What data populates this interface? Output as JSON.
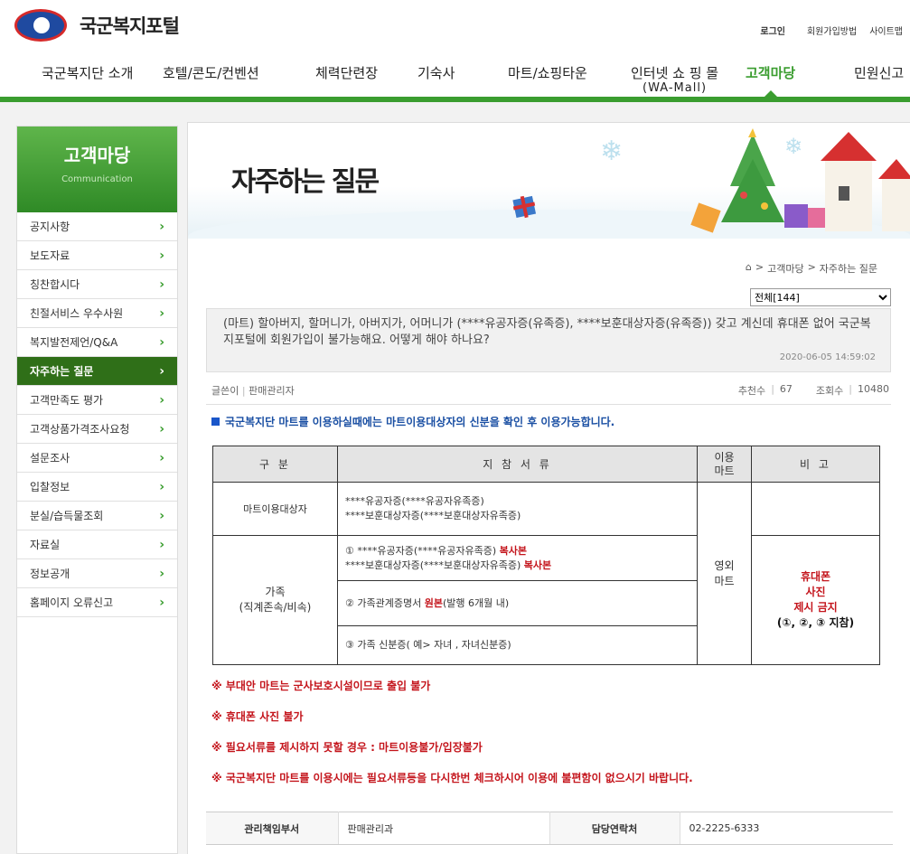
{
  "header": {
    "site_title": "국군복지포털",
    "util": {
      "login": "로그인",
      "signup_guide": "회원가입방법",
      "sitemap": "사이트맵"
    },
    "gnb": [
      {
        "label": "국군복지단 소개"
      },
      {
        "label": "호텔/콘도/컨벤션"
      },
      {
        "label": "체력단련장"
      },
      {
        "label": "기숙사"
      },
      {
        "label": "마트/쇼핑타운"
      },
      {
        "label": "인터넷 쇼 핑 몰",
        "sub": "(WA-Mall)"
      },
      {
        "label": "고객마당",
        "active": true
      },
      {
        "label": "민원신고"
      }
    ]
  },
  "sidebar": {
    "title": "고객마당",
    "subtitle": "Communication",
    "items": [
      {
        "label": "공지사항"
      },
      {
        "label": "보도자료"
      },
      {
        "label": "칭찬합시다"
      },
      {
        "label": "친절서비스 우수사원"
      },
      {
        "label": "복지발전제언/Q&A"
      },
      {
        "label": "자주하는 질문",
        "active": true
      },
      {
        "label": "고객만족도 평가"
      },
      {
        "label": "고객상품가격조사요청"
      },
      {
        "label": "설문조사"
      },
      {
        "label": "입찰정보"
      },
      {
        "label": "분실/습득물조회"
      },
      {
        "label": "자료실"
      },
      {
        "label": "정보공개"
      },
      {
        "label": "홈페이지 오류신고"
      }
    ]
  },
  "content": {
    "page_title": "자주하는 질문",
    "breadcrumb": {
      "home_icon": "home-icon",
      "level1": "고객마당",
      "level2": "자주하는 질문"
    },
    "filter": {
      "selected": "전체[144]"
    },
    "question": {
      "text": "(마트) 할아버지, 할머니가, 아버지가, 어머니가 (****유공자증(유족증), ****보훈대상자증(유족증)) 갖고 계신데 휴대폰 없어 국군복지포털에 회원가입이 불가능해요. 어떻게 해야 하나요?",
      "date": "2020-06-05 14:59:02"
    },
    "meta": {
      "writer_label": "글쓴이",
      "writer": "판매관리자",
      "recommend_label": "추천수",
      "recommend": "67",
      "views_label": "조회수",
      "views": "10480"
    },
    "notice": "국군복지단 마트를 이용하실때에는 마트이용대상자의 신분을 확인 후 이용가능합니다.",
    "table": {
      "headers": {
        "category": "구 분",
        "docs": "지 참 서 류",
        "mart": "이용\n마트",
        "note": "비 고"
      },
      "row1": {
        "category": "마트이용대상자",
        "doc_line1": "****유공자증(****유공자유족증)",
        "doc_line2": "****보훈대상자증(****보훈대상자유족증)"
      },
      "row2": {
        "category_line1": "가족",
        "category_line2": "(직계존속/비속)",
        "doc1_line1": "① ****유공자증(****유공자유족증) ",
        "doc1_line1_red": "복사본",
        "doc1_line2": "****보훈대상자증(****보훈대상자유족증) ",
        "doc1_line2_red": "복사본",
        "doc2_pre": "② 가족관계증명서 ",
        "doc2_red": "원본",
        "doc2_post": "(발행 6개월 내)",
        "doc3": "③ 가족 신분증( 예> 자녀 , 자녀신분증)"
      },
      "mart": "영외\n마트",
      "note_line1": "휴대폰",
      "note_line2": "사진",
      "note_line3": "제시 금지",
      "note_line4": "(①, ②, ③ 지참)"
    },
    "warnings": [
      "※ 부대안 마트는 군사보호시설이므로 출입 불가",
      "※ 휴대폰 사진 불가",
      "※ 필요서류를 제시하지 못할 경우 : 마트이용불가/입장불가",
      "※ 국군복지단 마트를 이용시에는 필요서류등을 다시한번 체크하시어 이용에 불편함이 없으시기 바랍니다."
    ],
    "contact": {
      "dept_label": "관리책임부서",
      "dept": "판매관리과",
      "phone_label": "담당연락처",
      "phone": "02-2225-6333"
    }
  },
  "colors": {
    "brand_green": "#3a9d2f",
    "active_sidebar": "#2f6f18",
    "red": "#c4151c",
    "notice_blue": "#1a4fa3"
  }
}
